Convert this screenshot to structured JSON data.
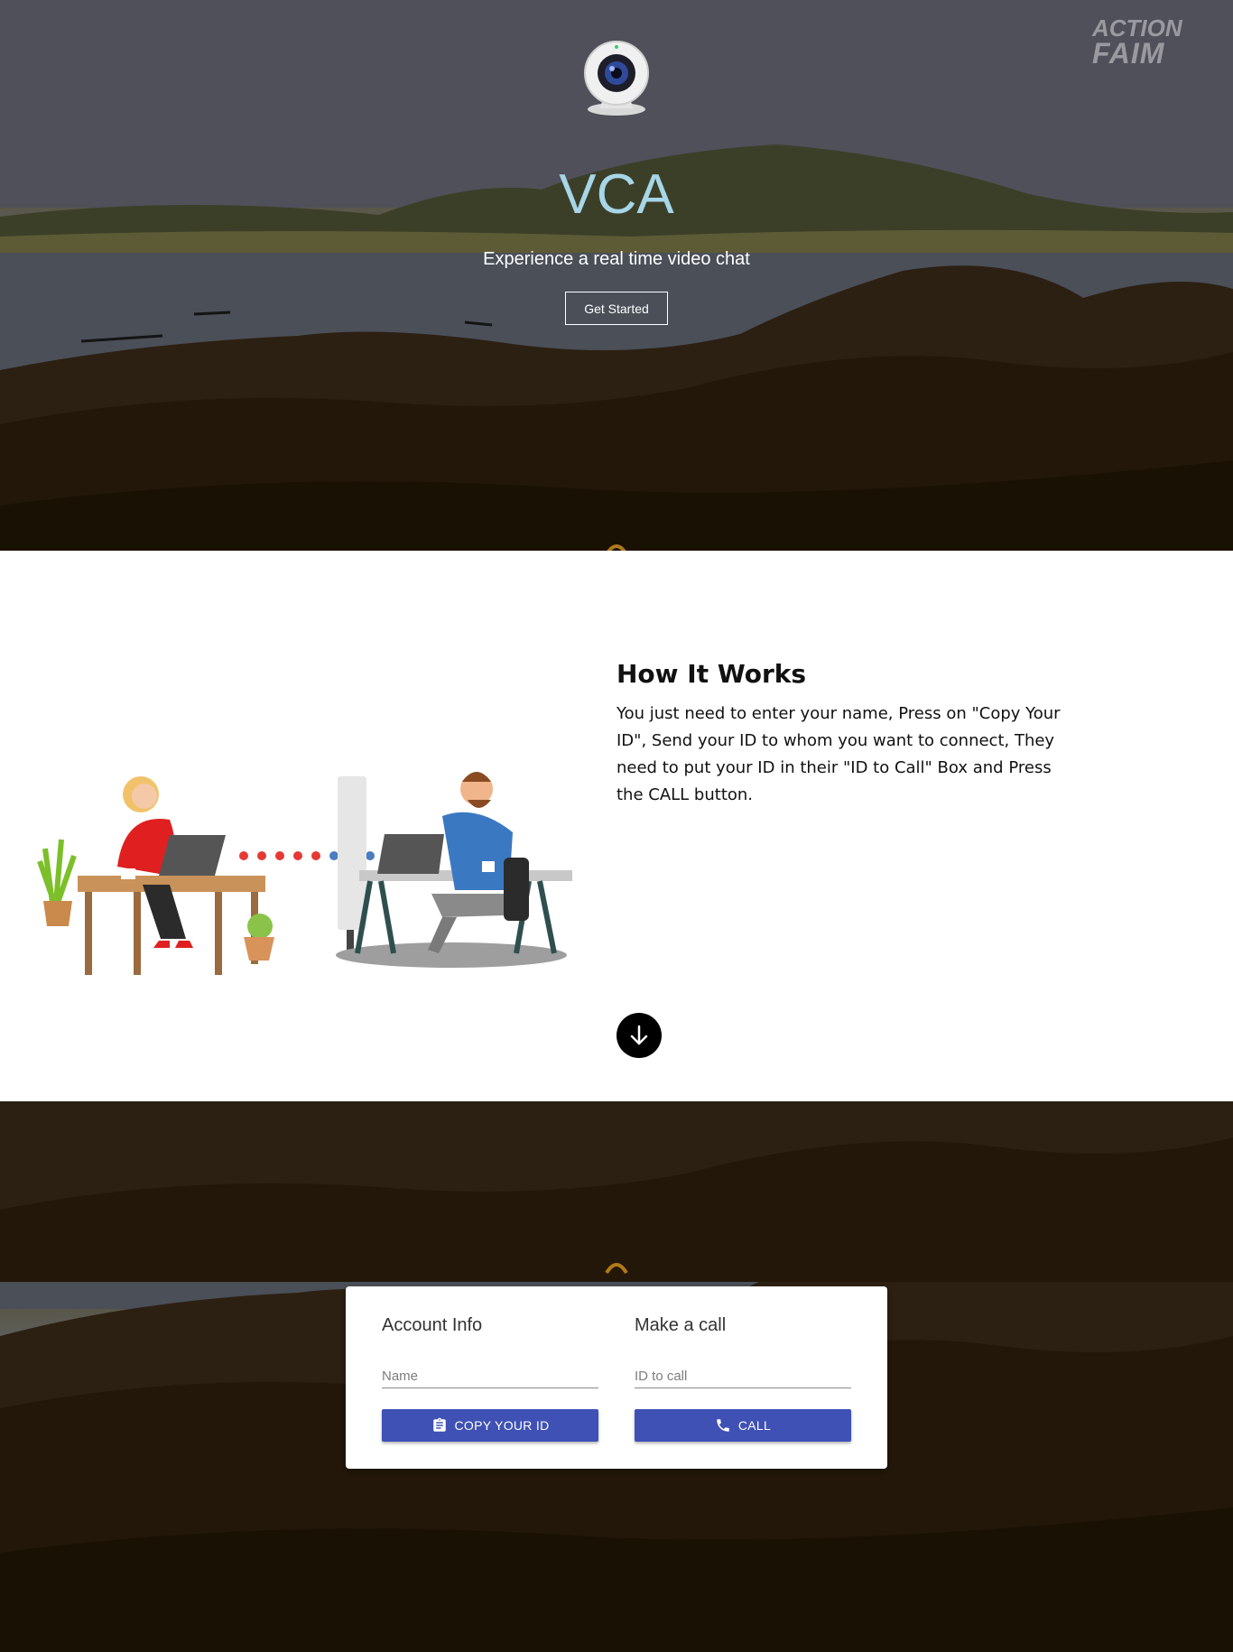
{
  "hero": {
    "logo": {
      "line1": "ACTION",
      "line2": "FAIM",
      "icon": "maple-leaf-icon"
    },
    "webcam_icon": "webcam-icon",
    "title": "VCA",
    "subtitle": "Experience a real time video chat",
    "cta_label": "Get Started"
  },
  "how_it_works": {
    "title": "How It Works",
    "body": "You just need to enter your name, Press on \"Copy Your ID\", Send your ID to whom you want to connect, They need to put your ID in their \"ID to Call\" Box and Press the CALL button.",
    "illustration": "two-people-video-call-illustration",
    "scroll_icon": "arrow-down-icon"
  },
  "call_panel": {
    "account": {
      "title": "Account Info",
      "name_placeholder": "Name",
      "name_value": "",
      "copy_button_label": "COPY YOUR ID",
      "copy_icon": "clipboard-icon"
    },
    "make_call": {
      "title": "Make a call",
      "id_placeholder": "ID to call",
      "id_value": "",
      "call_button_label": "CALL",
      "call_icon": "phone-icon"
    }
  },
  "colors": {
    "title_accent": "#a6d6e7",
    "primary_button": "#3f51b5"
  }
}
